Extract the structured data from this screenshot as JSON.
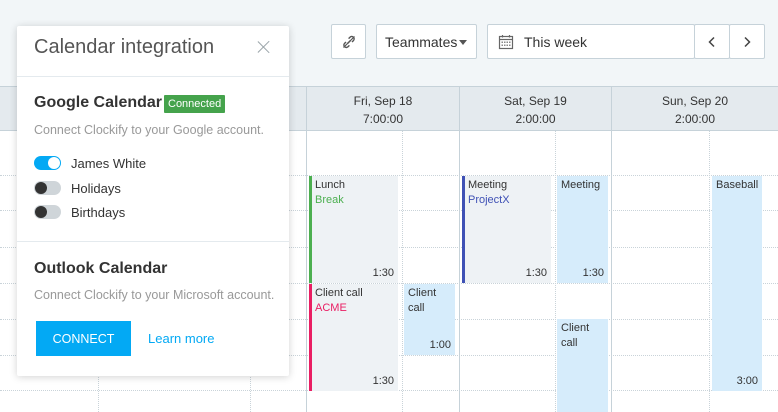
{
  "toolbar": {
    "link_icon": "link-off-icon",
    "teammates_label": "Teammates",
    "range_icon": "calendar-icon",
    "range_label": "This week",
    "prev_icon": "chevron-left-icon",
    "next_icon": "chevron-right-icon"
  },
  "days": [
    {
      "label": "Fri, Sep 18",
      "total": "7:00:00"
    },
    {
      "label": "Sat, Sep 19",
      "total": "2:00:00"
    },
    {
      "label": "Sun, Sep 20",
      "total": "2:00:00"
    }
  ],
  "entries": [
    {
      "description": "Lunch",
      "project": "Break",
      "project_color": "#4caf50",
      "duration": "1:30"
    },
    {
      "description": "Client call",
      "project": "ACME",
      "project_color": "#e91e63",
      "duration": "1:30"
    },
    {
      "description": "Client call",
      "project": "",
      "duration": "1:00"
    },
    {
      "description": "Meeting",
      "project": "ProjectX",
      "project_color": "#3f51b5",
      "duration": "1:30"
    },
    {
      "description": "Meeting",
      "project": "",
      "duration": "1:30"
    },
    {
      "description": "Client call",
      "project": "",
      "duration": ""
    },
    {
      "description": "Baseball",
      "project": "",
      "duration": "3:00"
    }
  ],
  "popup": {
    "title": "Calendar integration",
    "close_icon": "close-icon",
    "google": {
      "title": "Google Calendar",
      "badge": "Connected",
      "description": "Connect Clockify to your Google account.",
      "calendars": [
        {
          "label": "James White",
          "enabled": true
        },
        {
          "label": "Holidays",
          "enabled": false
        },
        {
          "label": "Birthdays",
          "enabled": false
        }
      ]
    },
    "outlook": {
      "title": "Outlook Calendar",
      "description": "Connect Clockify to your Microsoft account.",
      "connect_label": "Connect",
      "learn_more_label": "Learn more"
    }
  },
  "colors": {
    "accent": "#03a9f4",
    "connected": "#45a34c",
    "event_bg": "#eef2f5",
    "event_blue_bg": "#d6ecfb"
  }
}
